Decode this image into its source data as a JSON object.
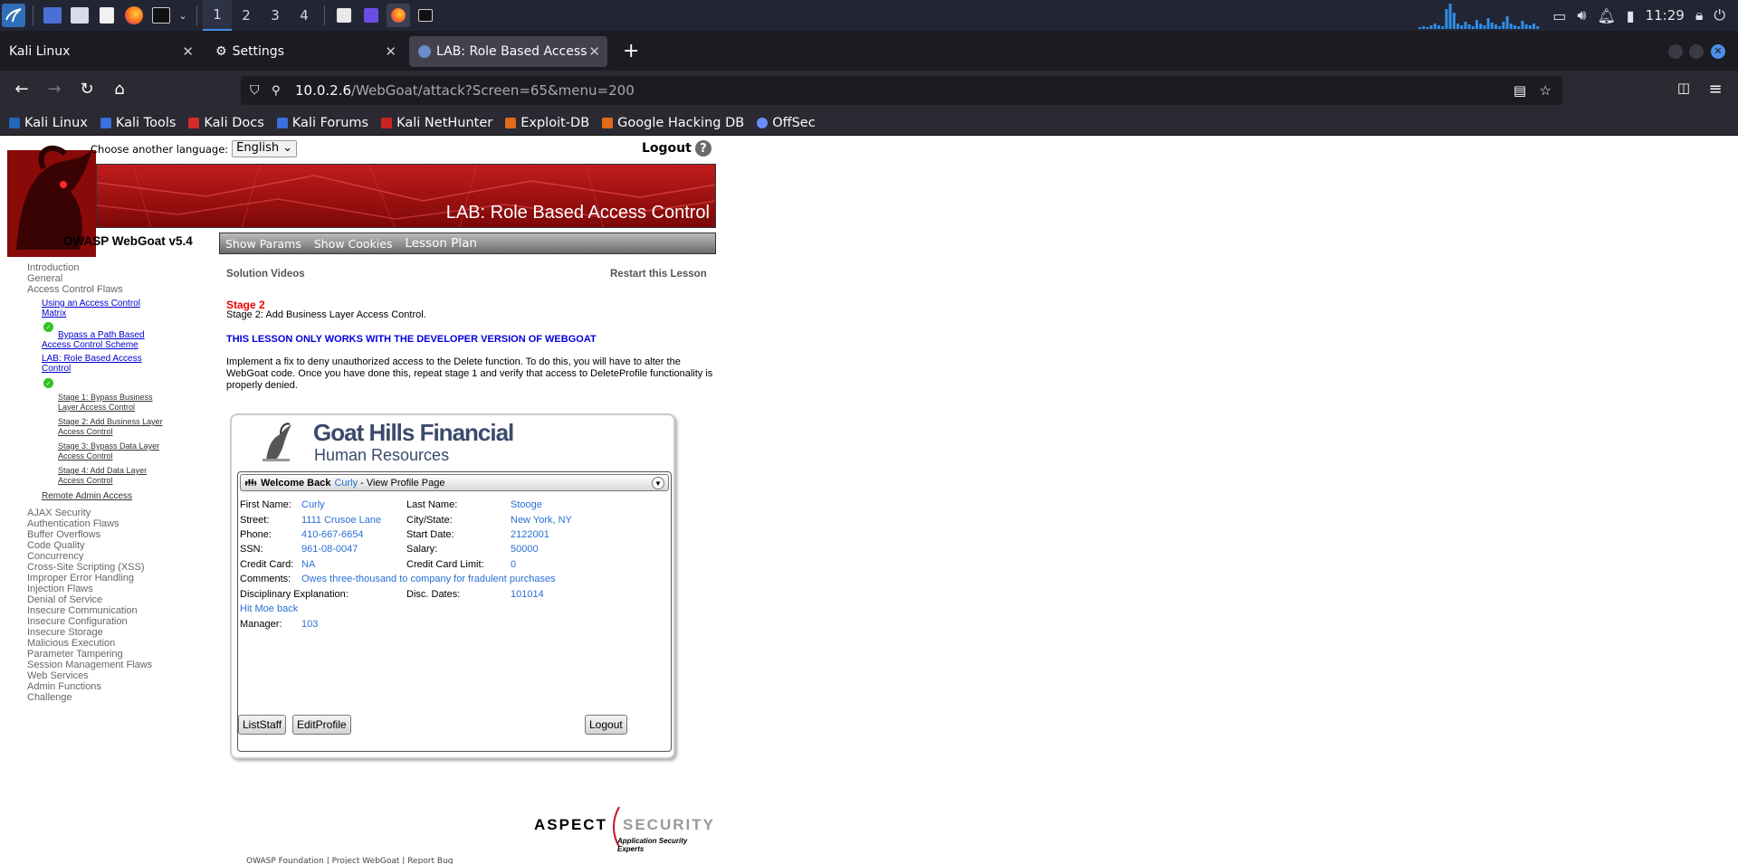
{
  "taskbar": {
    "workspaces": [
      "1",
      "2",
      "3",
      "4"
    ],
    "active_workspace": "1",
    "clock": "11:29"
  },
  "browser": {
    "tabs": [
      {
        "label": "Kali Linux"
      },
      {
        "label": "Settings"
      },
      {
        "label": "LAB: Role Based Access C"
      }
    ],
    "url_host": "10.0.2.6",
    "url_path": "/WebGoat/attack?Screen=65&menu=200",
    "bookmarks": [
      "Kali Linux",
      "Kali Tools",
      "Kali Docs",
      "Kali Forums",
      "Kali NetHunter",
      "Exploit-DB",
      "Google Hacking DB",
      "OffSec"
    ]
  },
  "header": {
    "language_label": "Choose another language:",
    "language_value": "English",
    "logout": "Logout",
    "banner_title": "LAB: Role Based Access Control",
    "product": "OWASP WebGoat  v5.4",
    "menu": [
      "Show Params",
      "Show Cookies",
      "Lesson Plan"
    ]
  },
  "nav": {
    "top": [
      "Introduction",
      "General",
      "Access Control Flaws"
    ],
    "sub": {
      "item1_l1": "Using an Access Control",
      "item1_l2": "Matrix",
      "item2_l1": "Bypass a Path Based",
      "item2_l2": "Access Control Scheme",
      "item3_l1": "LAB: Role Based Access",
      "item3_l2": "Control",
      "stage1_l1": "Stage 1: Bypass Business",
      "stage1_l2": "Layer Access Control",
      "stage2_l1": "Stage 2: Add Business Layer",
      "stage2_l2": "Access Control",
      "stage3_l1": "Stage 3: Bypass Data Layer",
      "stage3_l2": "Access Control",
      "stage4_l1": "Stage 4: Add Data Layer",
      "stage4_l2": "Access Control",
      "remote": "Remote Admin Access"
    },
    "bottom": [
      "AJAX Security",
      "Authentication Flaws",
      "Buffer Overflows",
      "Code Quality",
      "Concurrency",
      "Cross-Site Scripting (XSS)",
      "Improper Error Handling",
      "Injection Flaws",
      "Denial of Service",
      "Insecure Communication",
      "Insecure Configuration",
      "Insecure Storage",
      "Malicious Execution",
      "Parameter Tampering",
      "Session Management Flaws",
      "Web Services",
      "Admin Functions",
      "Challenge"
    ]
  },
  "lesson": {
    "solution_videos": "Solution Videos",
    "restart": "Restart this Lesson",
    "stage_title": "Stage 2",
    "stage_desc": "Stage 2: Add Business Layer Access Control.",
    "dev_warning": "THIS LESSON ONLY WORKS WITH THE DEVELOPER VERSION OF WEBGOAT",
    "instructions": "Implement a fix to deny unauthorized access to the Delete function. To do this, you will have to alter the WebGoat code. Once you have done this, repeat stage 1 and verify that access to DeleteProfile functionality is properly denied."
  },
  "ghf": {
    "title": "Goat Hills Financial",
    "subtitle": "Human Resources",
    "welcome": "Welcome Back",
    "user": "Curly",
    "page": "- View Profile Page",
    "labels": {
      "first_name": "First Name:",
      "last_name": "Last Name:",
      "street": "Street:",
      "city_state": "City/State:",
      "phone": "Phone:",
      "start_date": "Start Date:",
      "ssn": "SSN:",
      "salary": "Salary:",
      "credit_card": "Credit Card:",
      "cc_limit": "Credit Card Limit:",
      "comments": "Comments:",
      "disciplinary": "Disciplinary Explanation:",
      "disc_dates": "Disc. Dates:",
      "manager": "Manager:"
    },
    "values": {
      "first_name": "Curly",
      "last_name": "Stooge",
      "street": "1111 Crusoe Lane",
      "city_state": "New York, NY",
      "phone": "410-667-6654",
      "start_date": "2122001",
      "ssn": "961-08-0047",
      "salary": "50000",
      "credit_card": "NA",
      "cc_limit": "0",
      "comments": "Owes three-thousand to company for fradulent purchases",
      "disciplinary": "Hit Moe back",
      "disc_dates": "101014",
      "manager": "103"
    },
    "buttons": {
      "list_staff": "ListStaff",
      "edit_profile": "EditProfile",
      "logout": "Logout"
    }
  },
  "footer": {
    "aspect": "ASPECT",
    "security": "SECURITY",
    "tagline": "Application Security Experts",
    "text": "OWASP Foundation | Project WebGoat | Report Bug"
  },
  "colors": {
    "banner_red": "#b01010",
    "link_blue": "#2a6fd6",
    "stage_red": "#ee0000"
  }
}
